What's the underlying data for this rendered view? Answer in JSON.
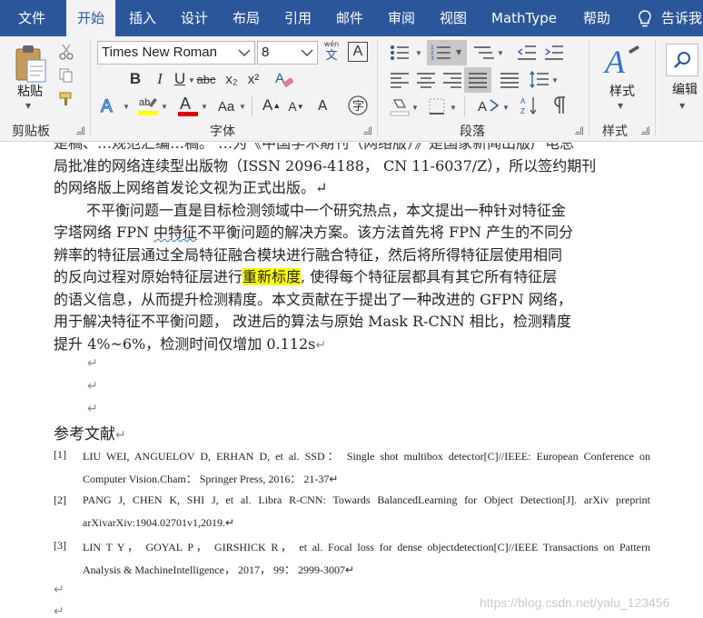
{
  "tabs": [
    {
      "label": "文件"
    },
    {
      "label": "开始"
    },
    {
      "label": "插入"
    },
    {
      "label": "设计"
    },
    {
      "label": "布局"
    },
    {
      "label": "引用"
    },
    {
      "label": "邮件"
    },
    {
      "label": "审阅"
    },
    {
      "label": "视图"
    },
    {
      "label": "MathType"
    },
    {
      "label": "帮助"
    },
    {
      "label": "告诉我"
    }
  ],
  "ribbon": {
    "clipboard": {
      "paste_label": "粘贴",
      "group_label": "剪贴板"
    },
    "font": {
      "font_name": "Times New Roman",
      "font_size": "8",
      "wen_label": "wén",
      "wen_char": "文",
      "bold": "B",
      "italic": "I",
      "underline": "U",
      "strike": "abc",
      "subscript": "x₂",
      "superscript": "x²",
      "grow": "A",
      "shrink": "A",
      "case": "Aa",
      "group_label": "字体"
    },
    "paragraph": {
      "group_label": "段落"
    },
    "styles": {
      "label": "样式",
      "group_label": "样式"
    },
    "editing": {
      "label": "编辑"
    }
  },
  "colors": {
    "ribbon_blue": "#2b579a",
    "highlight": "#ffff00",
    "font_red": "#e00000"
  },
  "document": {
    "clipped_top": "是稿、…规范汇编…稿。 …为《中国学术期刊（网络版）》是国家新闻出版广电总",
    "para1": [
      "局批准的网络连续型出版物（ISSN 2096-4188，  CN 11-6037/Z），所以签约期刊",
      "的网络版上网络首发论文视为正式出版。↵"
    ],
    "para2": {
      "l1": "不平衡问题一直是目标检测领域中一个研究热点，本文提出一种针对特征金",
      "l2a": "字塔网络  FPN  ",
      "l2b": "中特征",
      "l2c": "不平衡问题的解决方案。该方法首先将  FPN  产生的不同分",
      "l3": "辨率的特征层通过全局特征融合模块进行融合特征，然后将所得特征层使用相同",
      "l4a": "的反向过程对原始特征层进行",
      "l4b": "重新标度",
      "l4c": ", 使得每个特征层都具有其它所有特征层",
      "l5": "的语义信息，从而提升检测精度。本文贡献在于提出了一种改进的  GFPN  网络，",
      "l6": "用于解决特征不平衡问题，  改进后的算法与原始  Mask R-CNN  相比，检测精度",
      "l7": "提升  4%~6%，检测时间仅增加  0.112s",
      "l7_mark": "↵"
    },
    "empty_marks": [
      "↵",
      "↵",
      "↵"
    ],
    "refs_heading": "参考文献",
    "refs_heading_mark": "↵",
    "references": [
      {
        "num": "[1]",
        "line1": "LIU WEI, ANGUELOV D, ERHAN D, et al. SSD： Single shot multibox detector[C]//IEEE: European Conference on",
        "line2": "Computer Vision.Cham： Springer Press, 2016： 21-37↵"
      },
      {
        "num": "[2]",
        "line1": "PANG J, CHEN K, SHI J, et al. Libra R-CNN: Towards BalancedLearning for Object Detection[J]. arXiv preprint",
        "line2": "arXivarXiv:1904.02701v1,2019.↵"
      },
      {
        "num": "[3]",
        "line1": "LIN T Y，  GOYAL P，  GIRSHICK R，  et al. Focal loss for dense objectdetection[C]//IEEE Transactions on Pattern",
        "line2": "Analysis & MachineIntelligence， 2017， 99： 2999-3007↵"
      }
    ],
    "trailing_marks": [
      "↵",
      "↵"
    ],
    "watermark": "https://blog.csdn.net/yalu_123456"
  }
}
